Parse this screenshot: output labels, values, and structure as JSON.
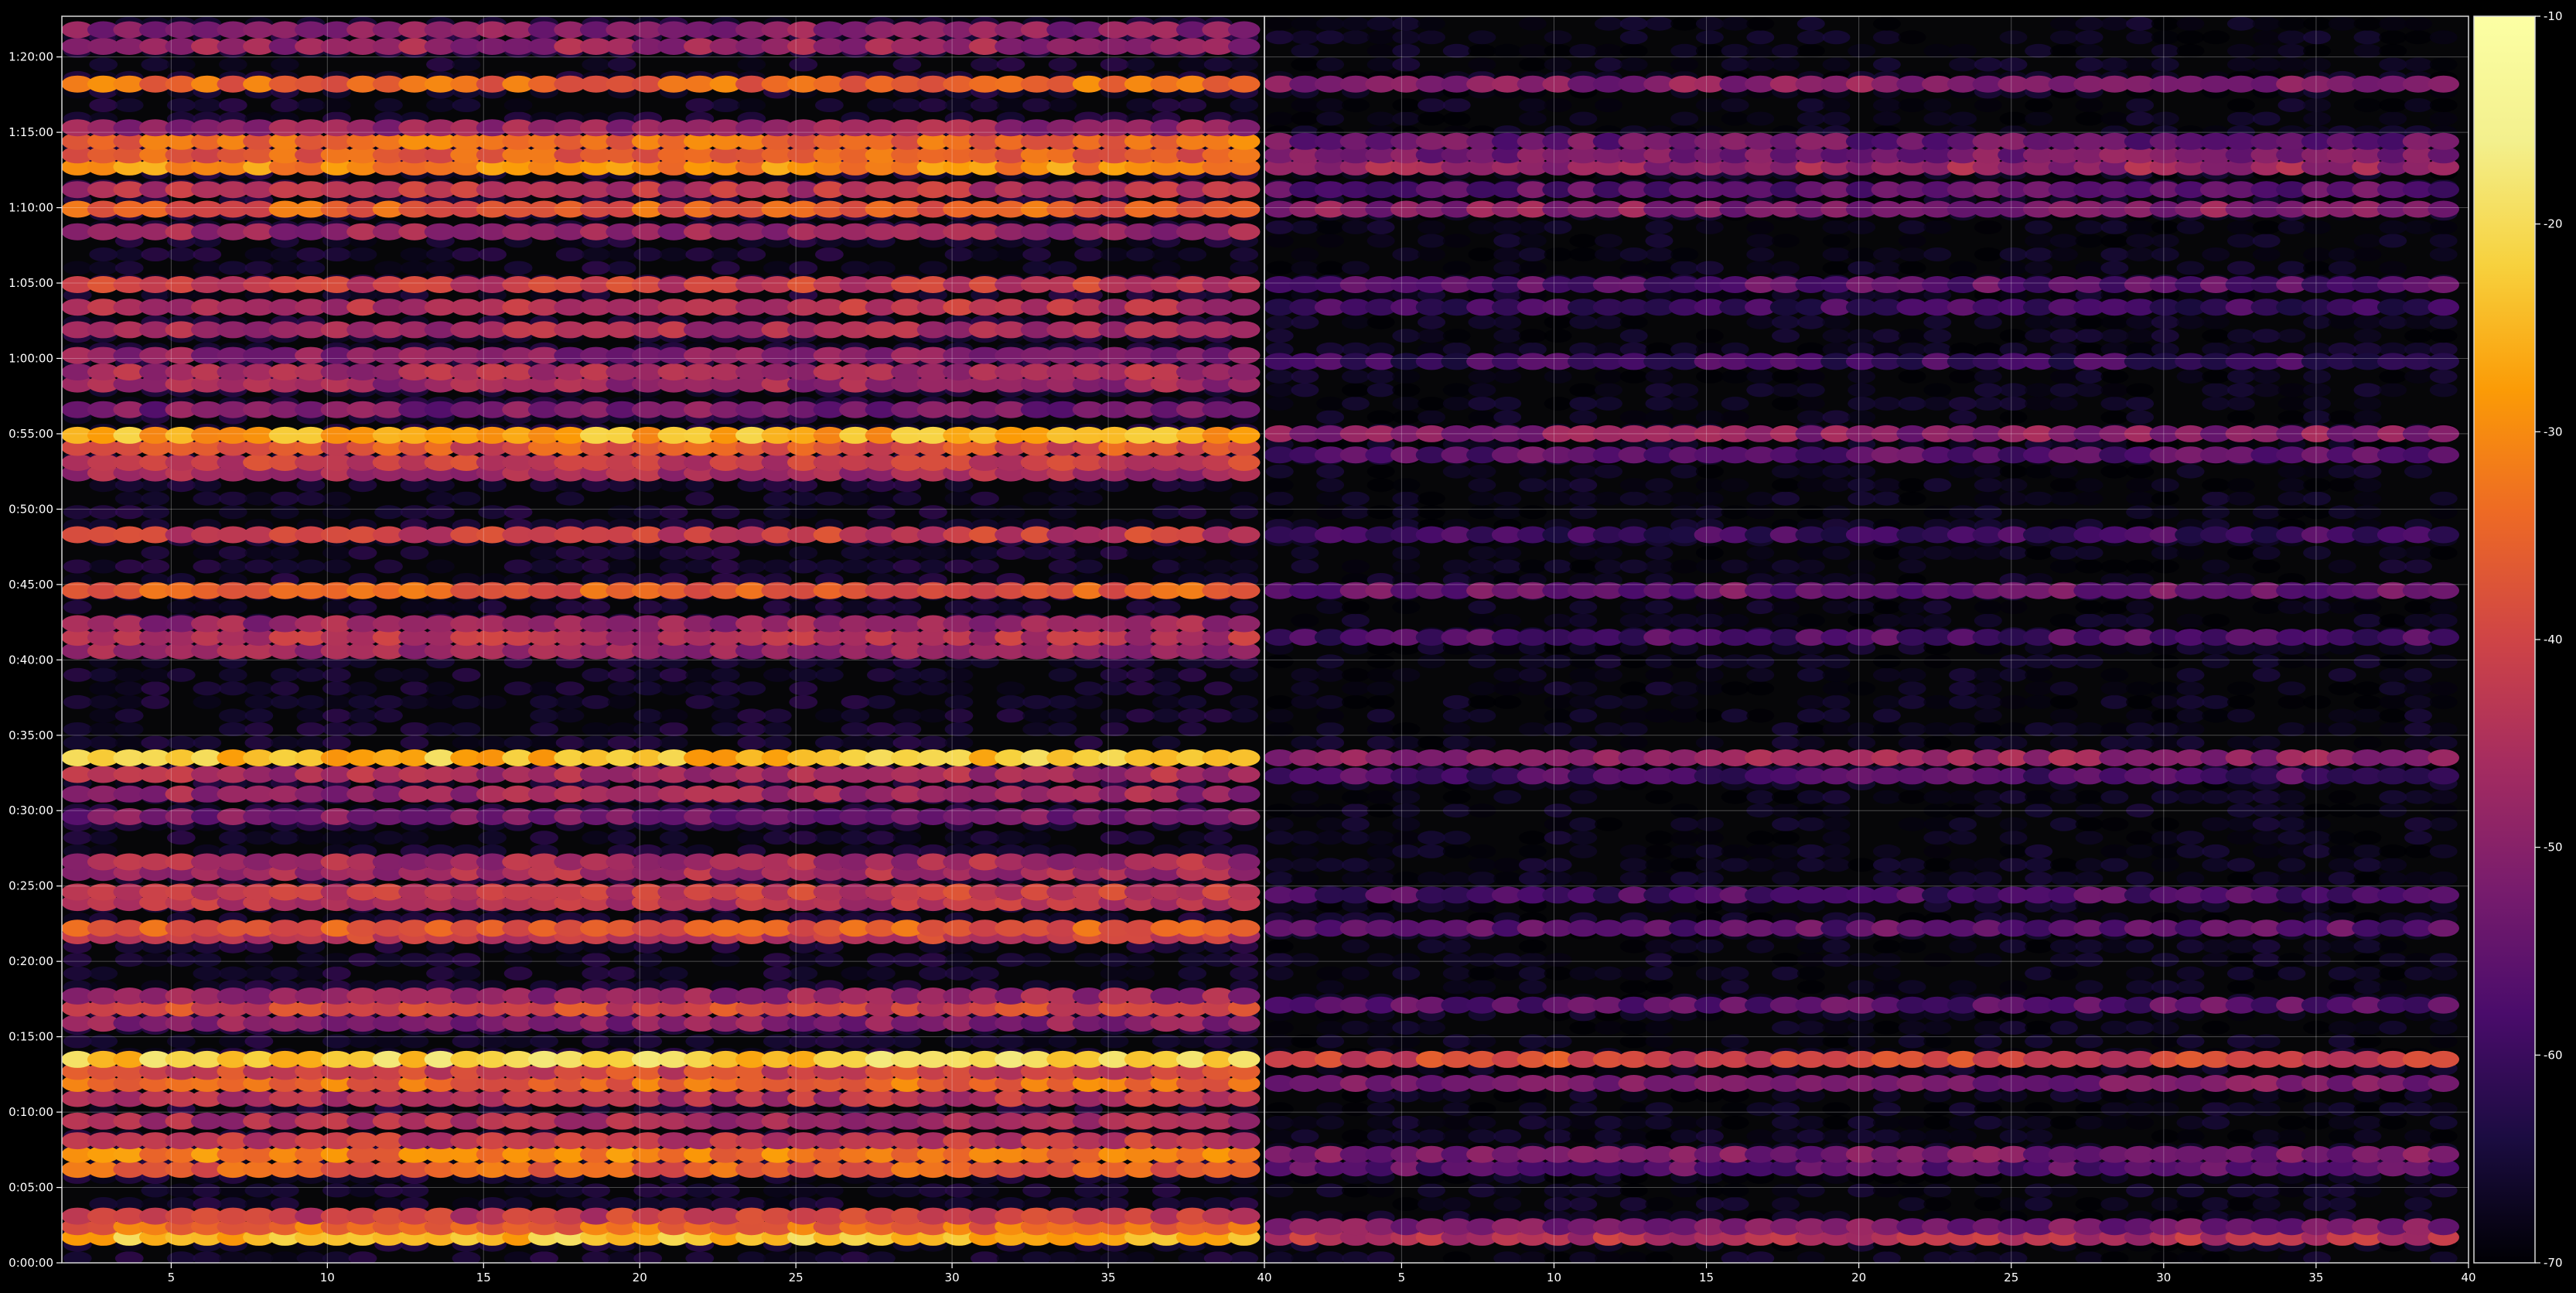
{
  "chart_data": {
    "type": "heatmap",
    "description": "Two side-by-side panels of spectrogram-like blobs; x = channel (1-40), y = elapsed time, color = intensity in dB on the inferno scale.",
    "panels": [
      {
        "name": "",
        "x_ticks": [
          "5",
          "10",
          "15",
          "20",
          "25",
          "30",
          "35"
        ],
        "xlim": [
          1.5,
          40
        ]
      },
      {
        "name": "",
        "x_ticks": [
          "5",
          "10",
          "15",
          "20",
          "25",
          "30",
          "35",
          "40"
        ],
        "xlim": [
          40,
          79.5
        ]
      }
    ],
    "y_ticks": [
      "0:00:00",
      "0:05:00",
      "0:10:00",
      "0:15:00",
      "0:20:00",
      "0:25:00",
      "0:30:00",
      "0:35:00",
      "0:40:00",
      "0:45:00",
      "0:50:00",
      "0:55:00",
      "1:00:00",
      "1:05:00",
      "1:10:00",
      "1:15:00",
      "1:20:00"
    ],
    "ylim_minutes": [
      0,
      82.7
    ],
    "x_tick_values_left": [
      5,
      10,
      15,
      20,
      25,
      30,
      35
    ],
    "x_tick_values_right": [
      5,
      10,
      15,
      20,
      25,
      30,
      35,
      40
    ],
    "colorbar": {
      "colormap": "inferno",
      "ticks": [
        "-10",
        "-20",
        "-30",
        "-40",
        "-50",
        "-60",
        "-70"
      ],
      "tick_values": [
        -10,
        -20,
        -30,
        -40,
        -50,
        -60,
        -70
      ],
      "range": [
        -70,
        -10
      ]
    },
    "grid": true,
    "left_bands": [
      {
        "t": 1.7,
        "v": -24
      },
      {
        "t": 2.4,
        "v": -34
      },
      {
        "t": 3.1,
        "v": -42
      },
      {
        "t": 6.2,
        "v": -36
      },
      {
        "t": 7.2,
        "v": -32
      },
      {
        "t": 8.1,
        "v": -42
      },
      {
        "t": 9.4,
        "v": -46
      },
      {
        "t": 10.9,
        "v": -44
      },
      {
        "t": 11.9,
        "v": -34
      },
      {
        "t": 12.7,
        "v": -40
      },
      {
        "t": 13.5,
        "v": -22
      },
      {
        "t": 15.9,
        "v": -50
      },
      {
        "t": 16.9,
        "v": -40
      },
      {
        "t": 17.7,
        "v": -48
      },
      {
        "t": 21.7,
        "v": -42
      },
      {
        "t": 22.2,
        "v": -36
      },
      {
        "t": 23.9,
        "v": -44
      },
      {
        "t": 24.6,
        "v": -42
      },
      {
        "t": 25.9,
        "v": -46
      },
      {
        "t": 26.6,
        "v": -46
      },
      {
        "t": 29.6,
        "v": -52
      },
      {
        "t": 31.1,
        "v": -48
      },
      {
        "t": 32.4,
        "v": -46
      },
      {
        "t": 33.5,
        "v": -24
      },
      {
        "t": 40.6,
        "v": -48
      },
      {
        "t": 41.5,
        "v": -44
      },
      {
        "t": 42.4,
        "v": -48
      },
      {
        "t": 44.6,
        "v": -36
      },
      {
        "t": 48.3,
        "v": -42
      },
      {
        "t": 52.4,
        "v": -46
      },
      {
        "t": 53.1,
        "v": -42
      },
      {
        "t": 54.1,
        "v": -38
      },
      {
        "t": 54.9,
        "v": -26
      },
      {
        "t": 56.6,
        "v": -52
      },
      {
        "t": 58.3,
        "v": -48
      },
      {
        "t": 59.1,
        "v": -46
      },
      {
        "t": 60.2,
        "v": -50
      },
      {
        "t": 61.9,
        "v": -46
      },
      {
        "t": 63.4,
        "v": -44
      },
      {
        "t": 64.9,
        "v": -42
      },
      {
        "t": 68.4,
        "v": -48
      },
      {
        "t": 69.9,
        "v": -36
      },
      {
        "t": 71.2,
        "v": -44
      },
      {
        "t": 72.7,
        "v": -30
      },
      {
        "t": 73.5,
        "v": -36
      },
      {
        "t": 74.4,
        "v": -34
      },
      {
        "t": 75.3,
        "v": -48
      },
      {
        "t": 78.2,
        "v": -34
      },
      {
        "t": 80.7,
        "v": -48
      },
      {
        "t": 81.8,
        "v": -50
      }
    ],
    "right_bands": [
      {
        "t": 1.7,
        "v": -44
      },
      {
        "t": 2.4,
        "v": -52
      },
      {
        "t": 6.3,
        "v": -56
      },
      {
        "t": 7.2,
        "v": -52
      },
      {
        "t": 11.9,
        "v": -52
      },
      {
        "t": 13.5,
        "v": -40
      },
      {
        "t": 17.1,
        "v": -56
      },
      {
        "t": 22.2,
        "v": -56
      },
      {
        "t": 24.4,
        "v": -58
      },
      {
        "t": 32.3,
        "v": -58
      },
      {
        "t": 33.5,
        "v": -48
      },
      {
        "t": 41.5,
        "v": -58
      },
      {
        "t": 44.6,
        "v": -54
      },
      {
        "t": 48.3,
        "v": -60
      },
      {
        "t": 53.6,
        "v": -56
      },
      {
        "t": 55.0,
        "v": -50
      },
      {
        "t": 59.8,
        "v": -60
      },
      {
        "t": 63.4,
        "v": -60
      },
      {
        "t": 64.9,
        "v": -56
      },
      {
        "t": 69.9,
        "v": -50
      },
      {
        "t": 71.2,
        "v": -56
      },
      {
        "t": 72.7,
        "v": -48
      },
      {
        "t": 73.5,
        "v": -52
      },
      {
        "t": 74.4,
        "v": -54
      },
      {
        "t": 78.2,
        "v": -50
      }
    ]
  }
}
